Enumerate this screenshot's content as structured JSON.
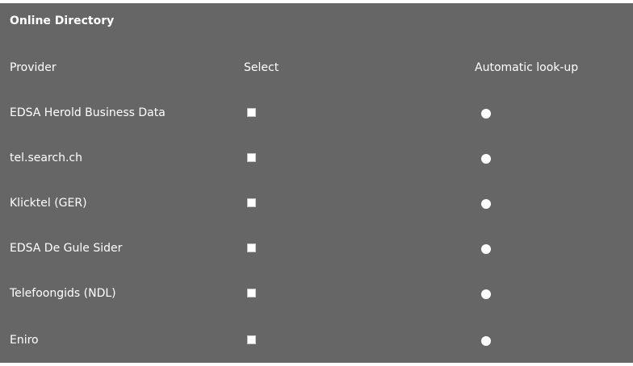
{
  "section": {
    "title": "Online Directory"
  },
  "columns": {
    "provider": "Provider",
    "select": "Select",
    "auto": "Automatic look-up"
  },
  "providers": [
    {
      "name": "EDSA Herold Business Data",
      "selected": false,
      "auto": false
    },
    {
      "name": "tel.search.ch",
      "selected": false,
      "auto": false
    },
    {
      "name": "Klicktel (GER)",
      "selected": false,
      "auto": false
    },
    {
      "name": "EDSA De Gule Sider",
      "selected": false,
      "auto": false
    },
    {
      "name": "Telefoongids (NDL)",
      "selected": false,
      "auto": false
    },
    {
      "name": "Eniro",
      "selected": false,
      "auto": false
    }
  ],
  "colors": {
    "panel_bg": "#666666",
    "text": "#ffffff"
  }
}
